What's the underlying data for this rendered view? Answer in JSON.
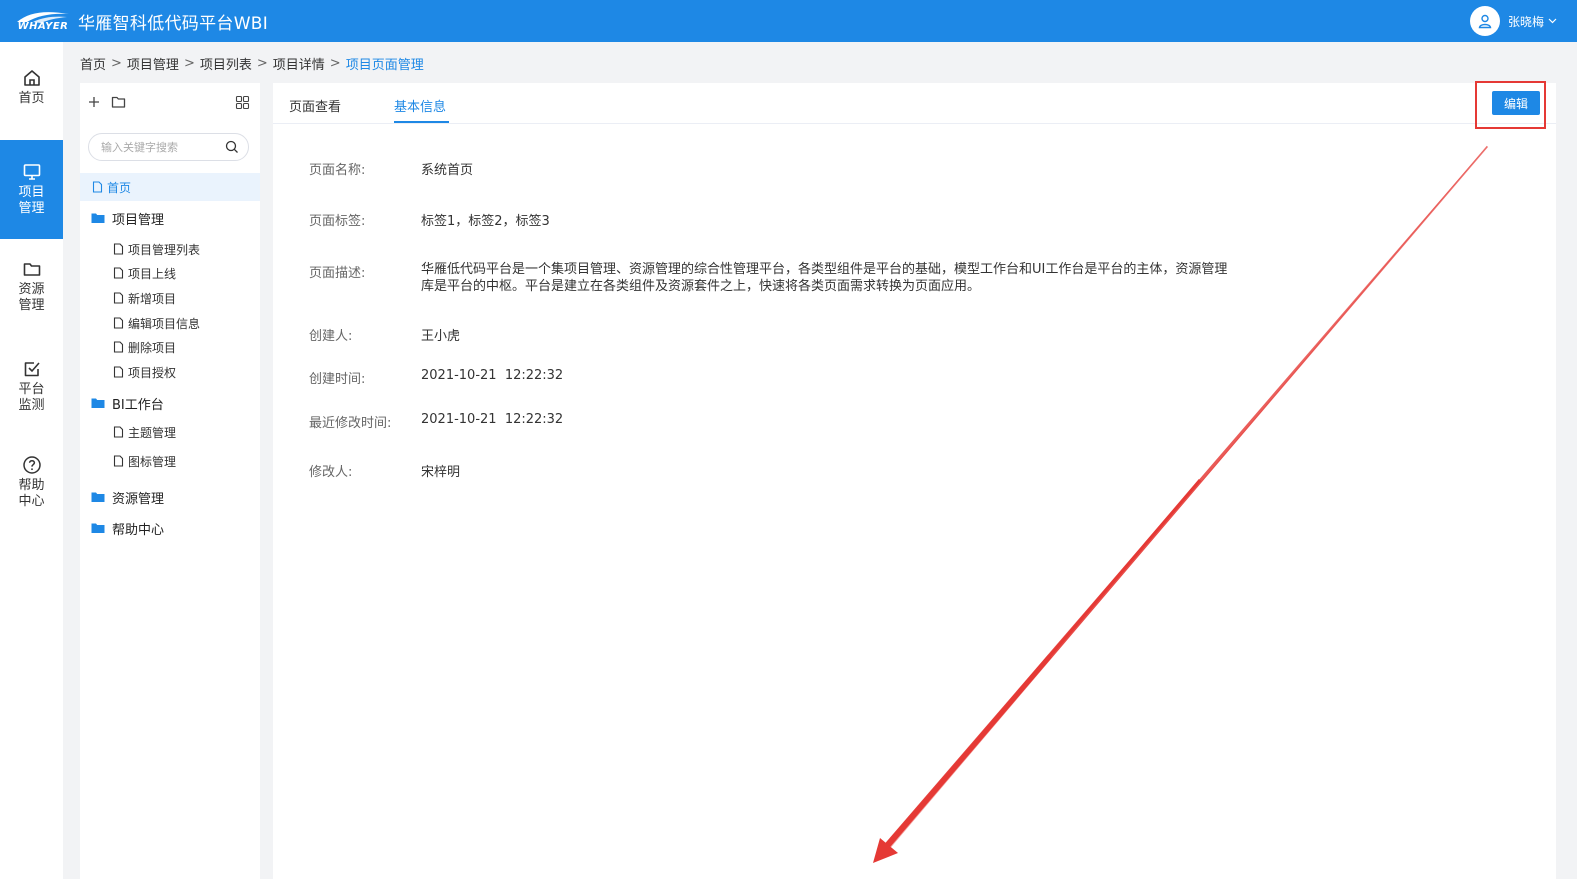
{
  "header": {
    "logo_text": "WHAYER",
    "app_title": "华雁智科低代码平台WBI",
    "user_name": "张晓梅"
  },
  "leftnav": [
    {
      "label": "首页",
      "icon": "home-icon",
      "active": false
    },
    {
      "label": "项目\n管理",
      "icon": "monitor-icon",
      "active": true
    },
    {
      "label": "资源\n管理",
      "icon": "folder-icon",
      "active": false
    },
    {
      "label": "平台\n监测",
      "icon": "checkbox-icon",
      "active": false
    },
    {
      "label": "帮助\n中心",
      "icon": "help-icon",
      "active": false
    }
  ],
  "breadcrumb": [
    "首页",
    "项目管理",
    "项目列表",
    "项目详情",
    "项目页面管理"
  ],
  "tree": {
    "search_placeholder": "输入关键字搜索",
    "items": [
      {
        "label": "首页",
        "type": "file",
        "selected": true
      },
      {
        "label": "项目管理",
        "type": "folder"
      },
      {
        "label": "项目管理列表",
        "type": "file"
      },
      {
        "label": "项目上线",
        "type": "file"
      },
      {
        "label": "新增项目",
        "type": "file"
      },
      {
        "label": "编辑项目信息",
        "type": "file"
      },
      {
        "label": "删除项目",
        "type": "file"
      },
      {
        "label": "项目授权",
        "type": "file"
      },
      {
        "label": "BI工作台",
        "type": "folder"
      },
      {
        "label": "主题管理",
        "type": "file"
      },
      {
        "label": "图标管理",
        "type": "file"
      },
      {
        "label": "资源管理",
        "type": "folder"
      },
      {
        "label": "帮助中心",
        "type": "folder"
      }
    ]
  },
  "tabs": [
    {
      "label": "页面查看",
      "active": false
    },
    {
      "label": "基本信息",
      "active": true
    }
  ],
  "edit_label": "编辑",
  "fields": [
    {
      "label": "页面名称:",
      "value": "系统首页"
    },
    {
      "label": "页面标签:",
      "value": "标签1，标签2，标签3"
    },
    {
      "label": "页面描述:",
      "value": "华雁低代码平台是一个集项目管理、资源管理的综合性管理平台，各类型组件是平台的基础，模型工作台和UI工作台是平台的主体，资源管理库是平台的中枢。平台是建立在各类组件及资源套件之上，快速将各类页面需求转换为页面应用。"
    },
    {
      "label": "创建人:",
      "value": "王小虎"
    },
    {
      "label": "创建时间:",
      "value": "2021-10-21  12:22:32"
    },
    {
      "label": "最近修改时间:",
      "value": "2021-10-21  12:22:32"
    },
    {
      "label": "修改人:",
      "value": "宋梓明"
    }
  ],
  "colors": {
    "primary": "#1e88e5",
    "annotation": "#e53935"
  }
}
